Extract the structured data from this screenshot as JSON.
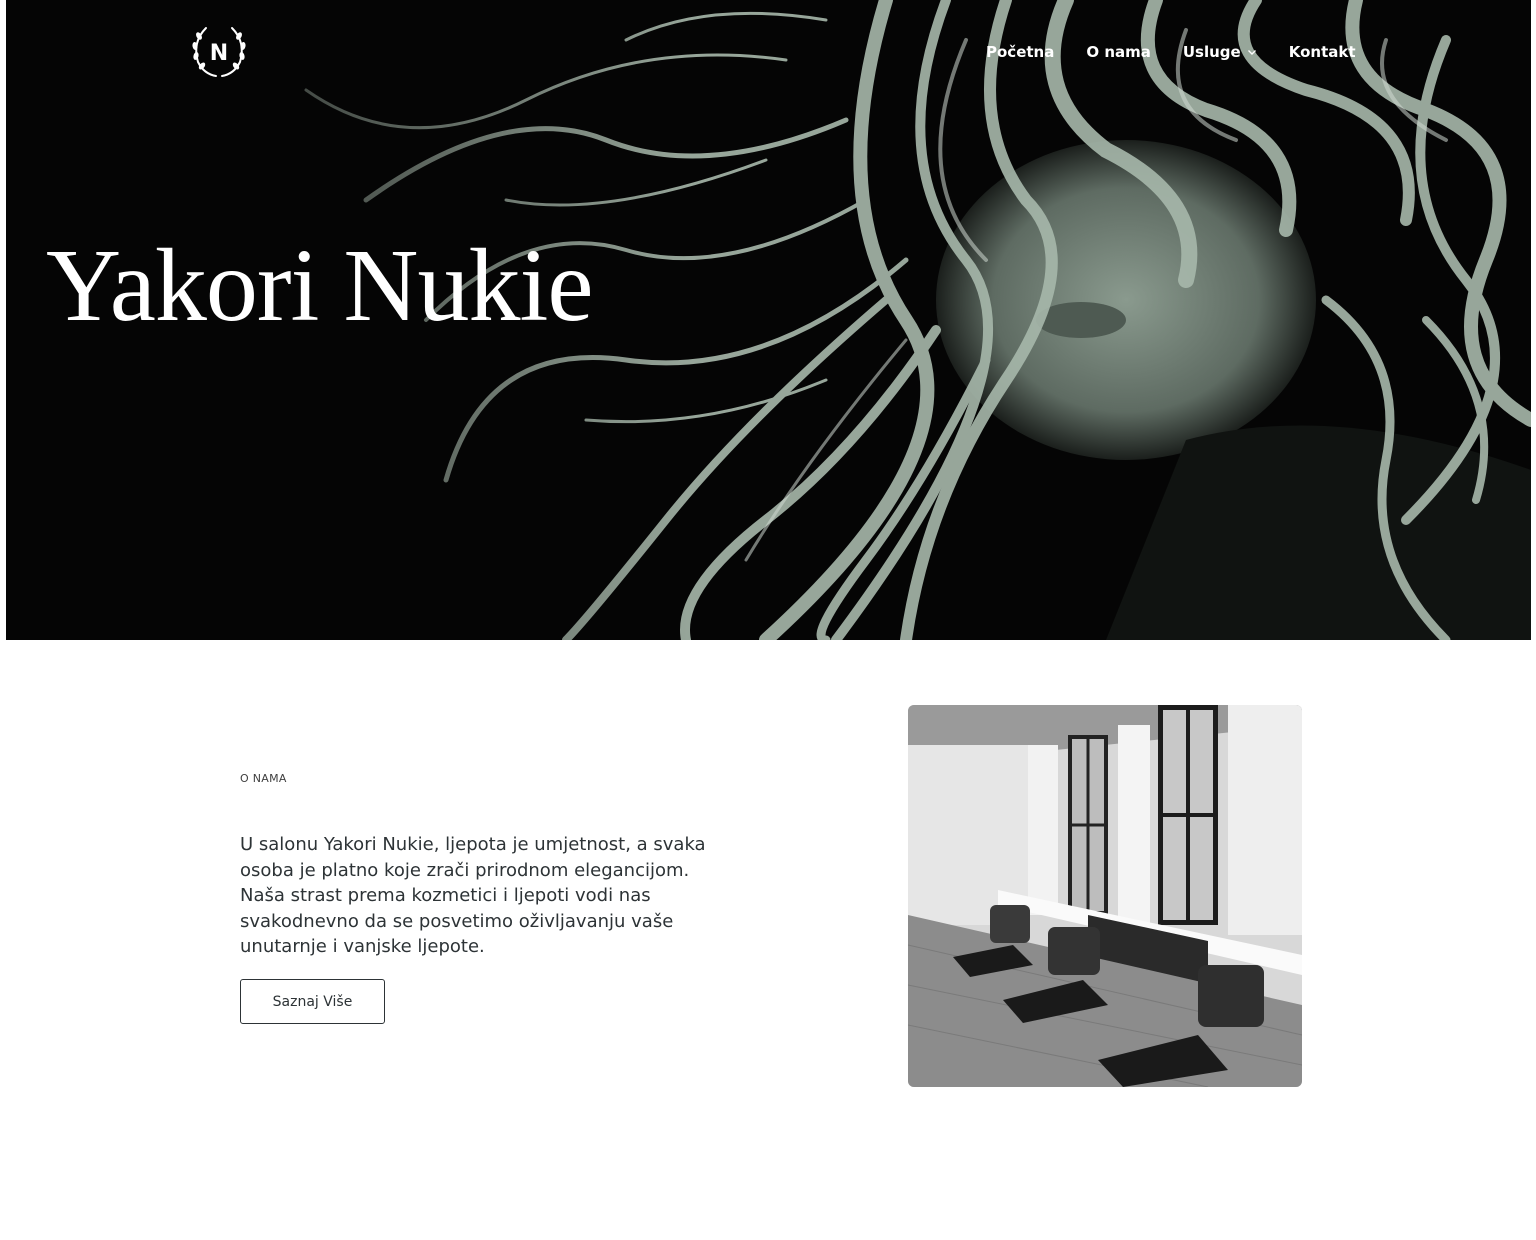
{
  "header": {
    "logo_letter": "N",
    "logo_icon": "laurel-wreath-icon",
    "nav": [
      {
        "label": "Početna"
      },
      {
        "label": "O nama"
      },
      {
        "label": "Usluge",
        "has_dropdown": true
      },
      {
        "label": "Kontakt"
      }
    ]
  },
  "hero": {
    "title": "Yakori Nukie",
    "image": "woman-with-flowing-hair-photo"
  },
  "about": {
    "label": "O NAMA",
    "text": "U salonu Yakori Nukie, ljepota je umjetnost, a svaka osoba je platno koje zrači prirodnom elegancijom. Naša strast prema kozmetici i ljepoti vodi nas svakodnevno da se posvetimo oživljavanju vaše unutarnje i vanjske ljepote.",
    "button_label": "Saznaj Više",
    "image": "salon-interior-photo"
  },
  "colors": {
    "hero_background": "#050505",
    "hair_tint": "#a7b8ab",
    "text": "#2d3336"
  }
}
